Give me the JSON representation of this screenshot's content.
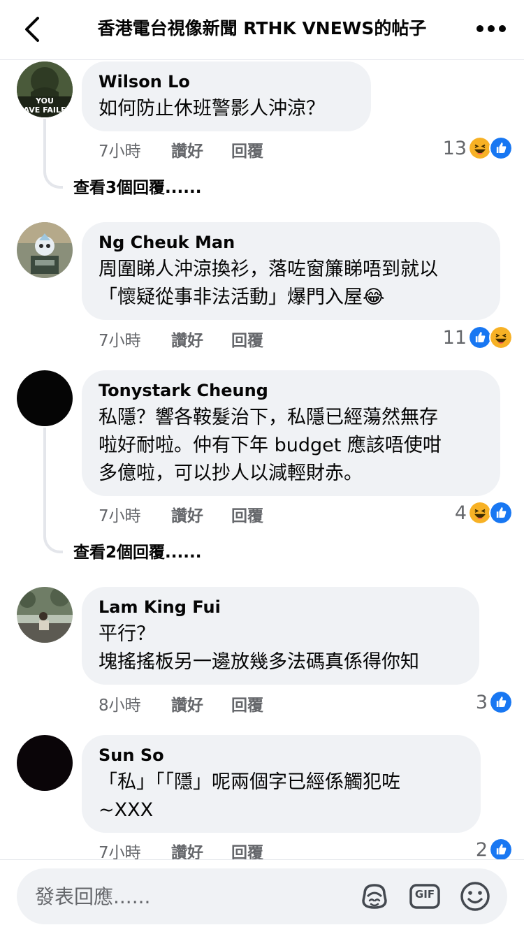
{
  "header": {
    "title": "香港電台視像新聞 RTHK VNEWS的帖子",
    "back_icon": "chevron-left-icon",
    "more_icon": "more-horizontal-icon"
  },
  "comments": [
    {
      "author": "Wilson Lo",
      "text": "如何防止休班警影人沖涼？",
      "time": "7小時",
      "like": "讚好",
      "reply": "回覆",
      "reaction_count": "13",
      "reactions": [
        "haha",
        "like"
      ],
      "view_replies": "查看3個回覆......",
      "avatar_text": "YOU\nAVE FAILE"
    },
    {
      "author": "Ng Cheuk Man",
      "text": "周圍睇人沖涼換衫，落咗窗簾睇唔到就以\n「懷疑從事非法活動」爆門入屋😂",
      "time": "7小時",
      "like": "讚好",
      "reply": "回覆",
      "reaction_count": "11",
      "reactions": [
        "like",
        "haha"
      ]
    },
    {
      "author": "Tonystark Cheung",
      "text": "私隱？響各鞍髮治下，私隱已經蕩然無存\n啦好耐啦。仲有下年 budget 應該唔使咁\n多億啦，可以抄人以減輕財赤。",
      "time": "7小時",
      "like": "讚好",
      "reply": "回覆",
      "reaction_count": "4",
      "reactions": [
        "haha",
        "like"
      ],
      "view_replies": "查看2個回覆......"
    },
    {
      "author": "Lam King Fui",
      "text": "平行？\n塊搖搖板另一邊放幾多法碼真係得你知",
      "time": "8小時",
      "like": "讚好",
      "reply": "回覆",
      "reaction_count": "3",
      "reactions": [
        "like"
      ]
    },
    {
      "author": "Sun So",
      "text": "「私」「「隱」呢兩個字已經係觸犯咗\n~XXX",
      "time": "7小時",
      "like": "讚好",
      "reply": "回覆",
      "reaction_count": "2",
      "reactions": [
        "like"
      ]
    }
  ],
  "composer": {
    "placeholder": "發表回應......",
    "avatar_sticker_icon": "avatar-sticker-icon",
    "gif_label": "GIF",
    "emoji_icon": "smiley-icon"
  },
  "colors": {
    "bubble": "#f0f2f5",
    "like_blue": "#1877f2",
    "haha_yellow": "#f7b125",
    "secondary_text": "#65676b"
  }
}
